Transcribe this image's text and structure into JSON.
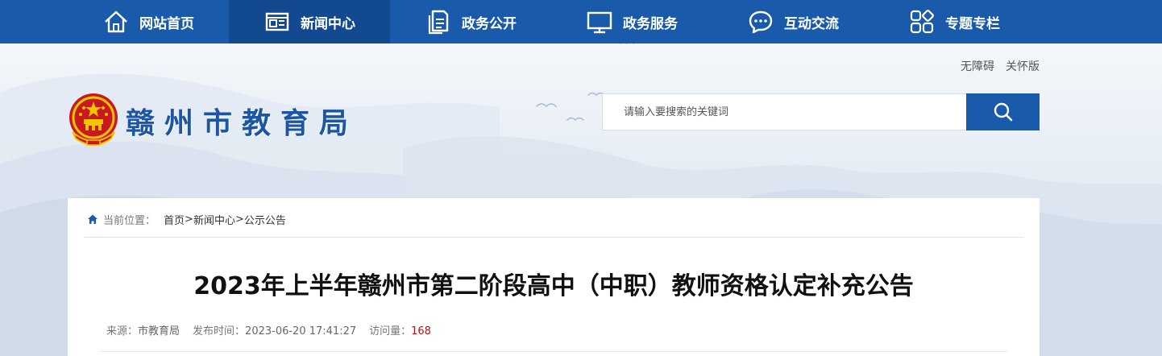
{
  "nav": {
    "items": [
      {
        "label": "网站首页",
        "icon": "home-icon"
      },
      {
        "label": "新闻中心",
        "icon": "newspaper-icon",
        "active": true
      },
      {
        "label": "政务公开",
        "icon": "document-icon"
      },
      {
        "label": "政务服务",
        "icon": "monitor-icon"
      },
      {
        "label": "互动交流",
        "icon": "chat-icon"
      },
      {
        "label": "专题专栏",
        "icon": "grid-icon"
      }
    ]
  },
  "util": {
    "accessibility": "无障碍",
    "elderly": "关怀版"
  },
  "site": {
    "name": "赣州市教育局",
    "emblem": "national-emblem"
  },
  "search": {
    "placeholder": "请输入要搜索的关键词"
  },
  "breadcrumb": {
    "label": "当前位置：",
    "items": [
      "首页",
      "新闻中心",
      "公示公告"
    ],
    "separator": ">"
  },
  "article": {
    "title": "2023年上半年赣州市第二阶段高中（中职）教师资格认定补充公告",
    "source_label": "来源：",
    "source": "市教育局",
    "date_label": "发布时间：",
    "date": "2023-06-20 17:41:27",
    "views_label": "访问量：",
    "views": "168"
  },
  "colors": {
    "nav_bg": "#1a5aaa",
    "nav_active": "#13498f",
    "site_name": "#1b55a3",
    "views": "#b4131b"
  }
}
